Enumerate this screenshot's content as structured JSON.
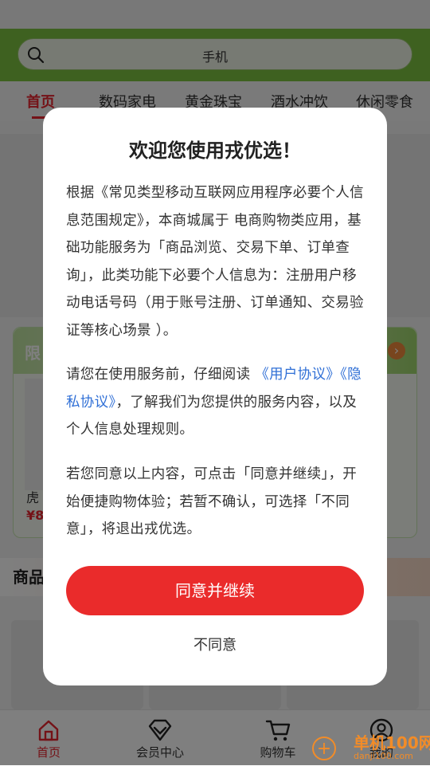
{
  "search": {
    "query": "手机"
  },
  "tabs": [
    {
      "label": "首页"
    },
    {
      "label": "数码家电"
    },
    {
      "label": "黄金珠宝"
    },
    {
      "label": "酒水冲饮"
    },
    {
      "label": "休闲零食"
    }
  ],
  "promo": {
    "tag": "限",
    "product_name": "虎",
    "price": "¥8",
    "more": "›"
  },
  "goods_section": {
    "title": "商品"
  },
  "modal": {
    "title": "欢迎您使用戎优选！",
    "para1": "根据《常见类型移动互联网应用程序必要个人信息范围规定》，本商城属于 电商购物类应用，基础功能服务为「商品浏览、交易下单、订单查询」，此类功能下必要个人信息为：注册用户移动电话号码（用于账号注册、订单通知、交易验证等核心场景 ）。",
    "para2_prefix": "请您在使用服务前，仔细阅读",
    "user_agreement": "《用户协议》",
    "privacy_policy": "《隐私协议》",
    "para2_suffix": "，了解我们为您提供的服务内容，以及个人信息处理规则。",
    "para3": "若您同意以上内容，可点击「同意并继续」，开始便捷购物体验；若暂不确认，可选择「不同意」，将退出戎优选。",
    "agree_label": "同意并继续",
    "disagree_label": "不同意"
  },
  "bottom_nav": [
    {
      "label": "首页",
      "icon": "home-icon"
    },
    {
      "label": "会员中心",
      "icon": "diamond-icon"
    },
    {
      "label": "购物车",
      "icon": "cart-icon"
    },
    {
      "label": "我的",
      "icon": "user-icon"
    }
  ],
  "watermark": {
    "line1": "单机100网",
    "line2": "danji100.com"
  },
  "colors": {
    "brand_green": "#7cc240",
    "accent_red": "#ea2b2b",
    "link_blue": "#2f6fd6"
  }
}
